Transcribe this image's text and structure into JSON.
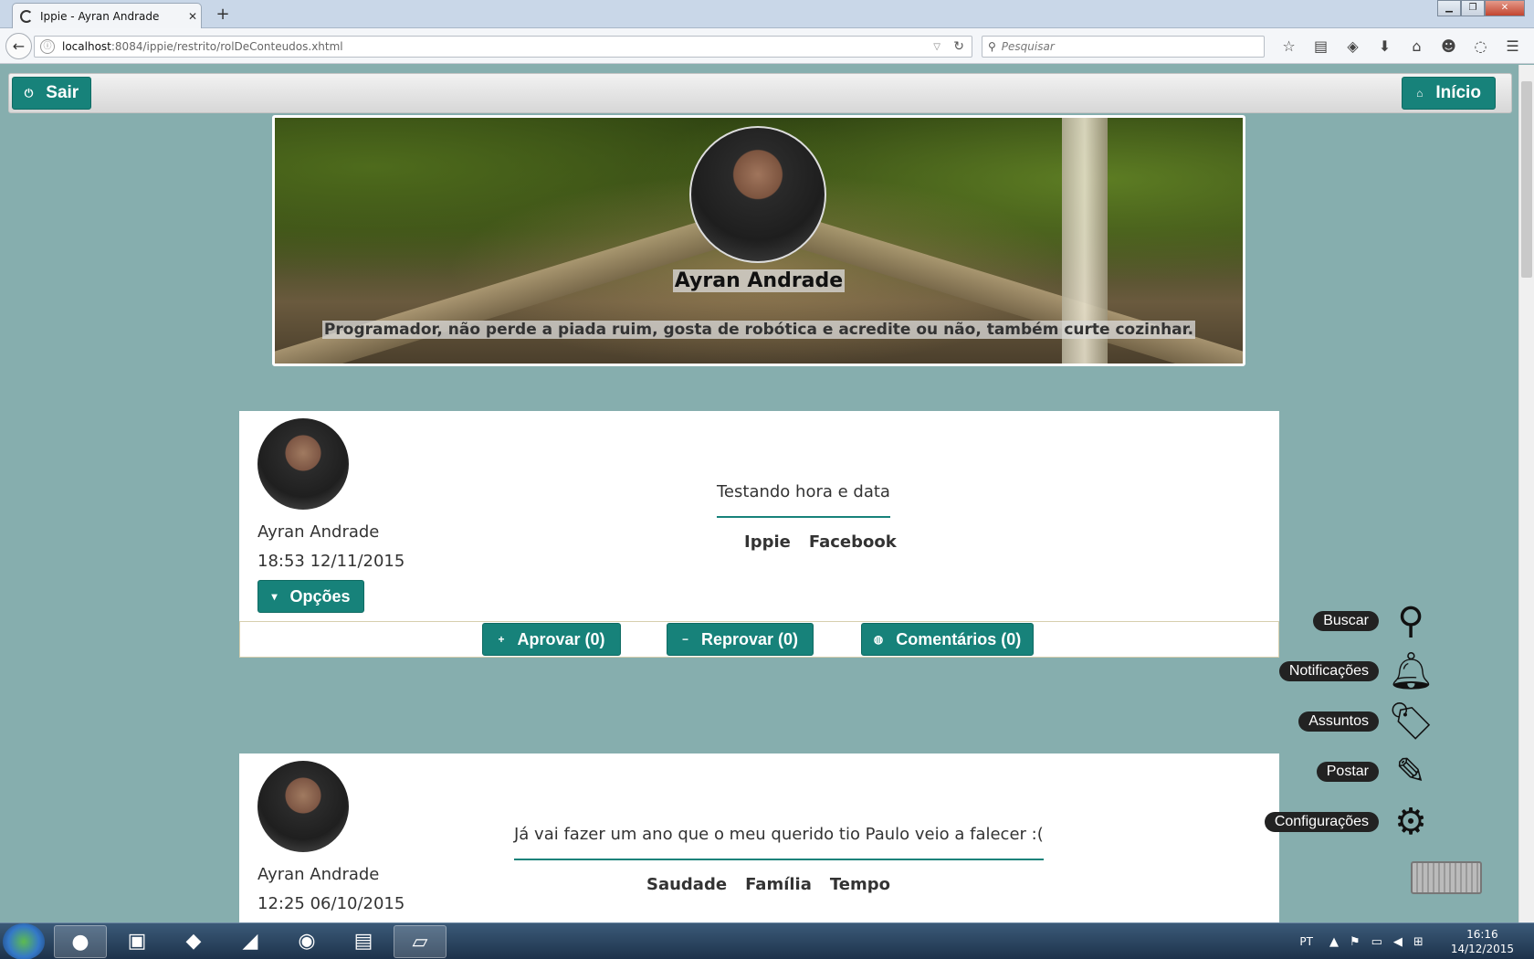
{
  "browser": {
    "tab_title": "Ippie - Ayran Andrade",
    "tab_close": "✕",
    "new_tab": "+",
    "url_host": "localhost",
    "url_path": ":8084/ippie/restrito/rolDeConteudos.xhtml",
    "search_placeholder": "Pesquisar"
  },
  "header": {
    "sair_label": "Sair",
    "inicio_label": "Início"
  },
  "profile": {
    "name": "Ayran Andrade",
    "bio": "Programador, não perde a piada ruim, gosta de robótica e acredite ou não, também curte cozinhar."
  },
  "posts": [
    {
      "author": "Ayran Andrade",
      "date": "18:53 12/11/2015",
      "options_label": "Opções",
      "text": "Testando hora e data",
      "tags": [
        "Ippie",
        "Facebook"
      ],
      "actions": {
        "approve": "Aprovar (0)",
        "reject": "Reprovar (0)",
        "comments": "Comentários (0)"
      }
    },
    {
      "author": "Ayran Andrade",
      "date": "12:25 06/10/2015",
      "text": "Já vai fazer um ano que o meu querido tio Paulo veio a falecer :(",
      "tags": [
        "Saudade",
        "Família",
        "Tempo"
      ]
    }
  ],
  "side_menu": {
    "buscar": "Buscar",
    "notificacoes": "Notificações",
    "assuntos": "Assuntos",
    "postar": "Postar",
    "configuracoes": "Configurações"
  },
  "taskbar": {
    "language": "PT",
    "time": "16:16",
    "date": "14/12/2015"
  },
  "colors": {
    "page_background": "#86aeae",
    "accent": "#17827a"
  }
}
